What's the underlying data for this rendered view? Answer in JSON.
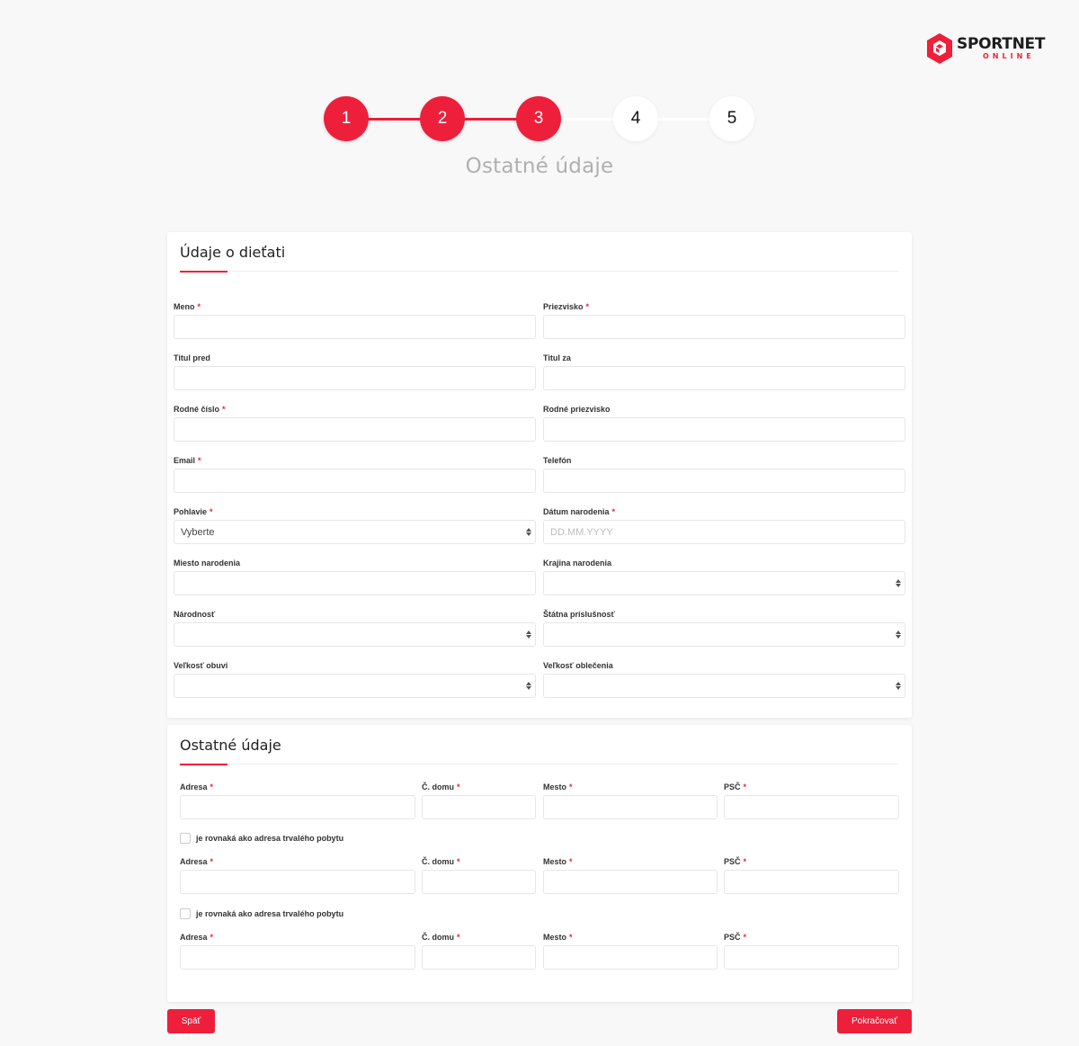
{
  "brand": {
    "name": "SPORTNET",
    "sub": "ONLINE",
    "accent": "#ee1f3b"
  },
  "steps": [
    {
      "label": "1",
      "state": "done"
    },
    {
      "label": "2",
      "state": "done"
    },
    {
      "label": "3",
      "state": "current"
    },
    {
      "label": "4",
      "state": "todo"
    },
    {
      "label": "5",
      "state": "todo"
    }
  ],
  "step_title": "Ostatné údaje",
  "child": {
    "title": "Údaje o dieťati",
    "meno": "Meno",
    "priezvisko": "Priezvisko",
    "titul_pred": "Titul pred",
    "titul_za": "Titul za",
    "rodne_cislo": "Rodné číslo",
    "rodne_priezvisko": "Rodné priezvisko",
    "email": "Email",
    "telefon": "Telefón",
    "pohlavie": "Pohlavie",
    "pohlavie_value": "Vyberte",
    "datum_narodenia": "Dátum narodenia",
    "datum_placeholder": "DD.MM.YYYY",
    "miesto_narodenia": "Miesto narodenia",
    "krajina_narodenia": "Krajina narodenia",
    "narodnost": "Národnosť",
    "statna_prislusnost": "Štátna príslušnosť",
    "velkost_obuvi": "Veľkosť obuvi",
    "velkost_oblecenia": "Veľkosť oblečenia"
  },
  "other": {
    "title": "Ostatné údaje",
    "adresa": "Adresa",
    "c_domu": "Č. domu",
    "mesto": "Mesto",
    "psc": "PSČ",
    "same_address": "je rovnaká ako adresa trvalého pobytu"
  },
  "required_mark": "*",
  "buttons": {
    "back": "Späť",
    "next": "Pokračovať"
  }
}
